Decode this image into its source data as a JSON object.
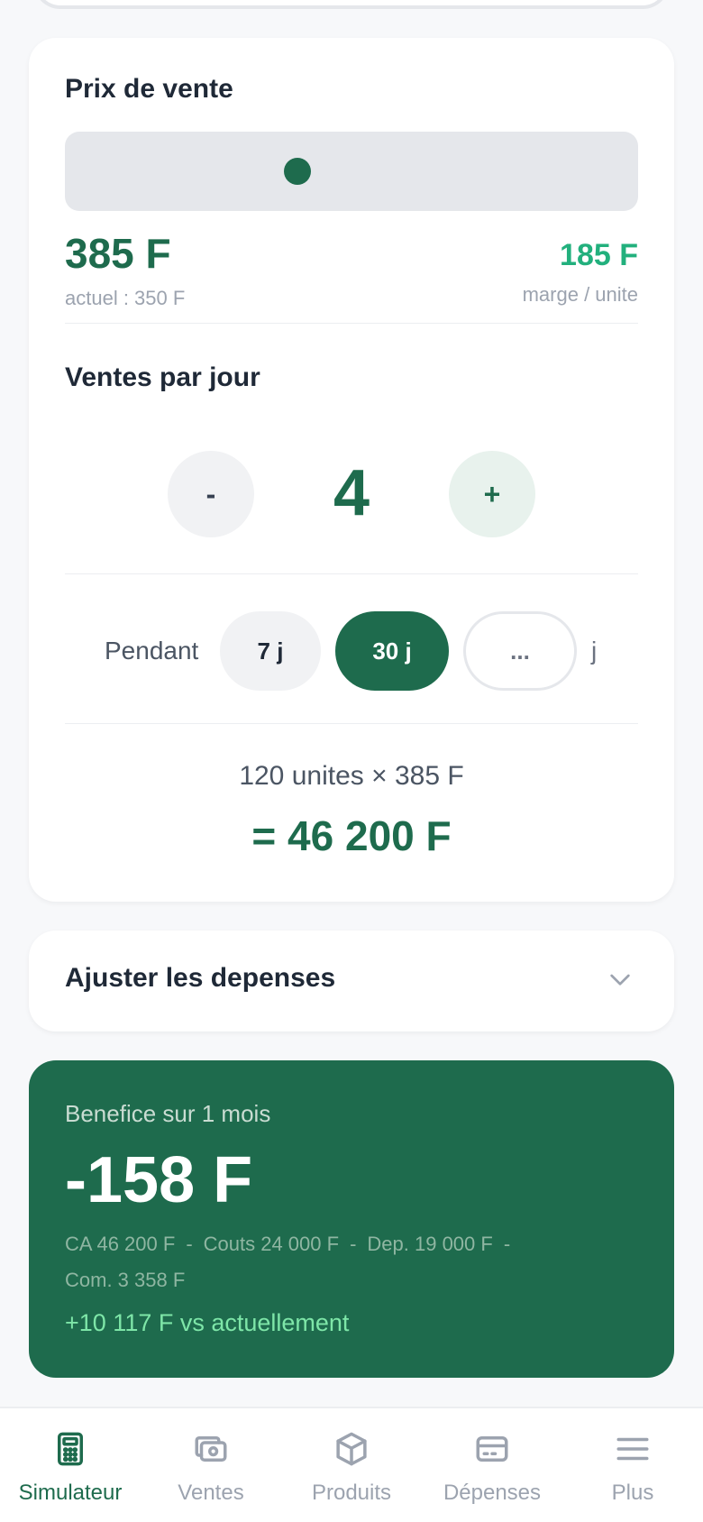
{
  "price": {
    "title": "Prix de vente",
    "slider_fraction": 0.405,
    "value": "385 F",
    "current": "actuel : 350 F",
    "margin_value": "185 F",
    "margin_label": "marge / unite"
  },
  "sales": {
    "title": "Ventes par jour",
    "minus_label": "-",
    "plus_label": "+",
    "quantity": "4"
  },
  "duration": {
    "label": "Pendant",
    "options": [
      "7 j",
      "30 j",
      "..."
    ],
    "selected": "30 j",
    "unit": "j"
  },
  "calc": {
    "line": "120 unites × 385 F",
    "total": "= 46 200 F"
  },
  "expenses": {
    "title": "Ajuster les depenses"
  },
  "profit": {
    "label": "Benefice sur 1 mois",
    "value": "-158 F",
    "details": [
      "CA 46 200 F",
      "Couts 24 000 F",
      "Dep. 19 000 F",
      "Com. 3 358 F"
    ],
    "separator": "-",
    "delta": "+10 117 F vs actuellement"
  },
  "nav": {
    "items": [
      {
        "label": "Simulateur",
        "icon": "calculator-icon",
        "active": true
      },
      {
        "label": "Ventes",
        "icon": "cash-icon",
        "active": false
      },
      {
        "label": "Produits",
        "icon": "box-icon",
        "active": false
      },
      {
        "label": "Dépenses",
        "icon": "card-icon",
        "active": false
      },
      {
        "label": "Plus",
        "icon": "menu-icon",
        "active": false
      }
    ]
  },
  "colors": {
    "primary": "#1e6b4d",
    "accent": "#22b07d",
    "positive": "#7ee6a8"
  }
}
